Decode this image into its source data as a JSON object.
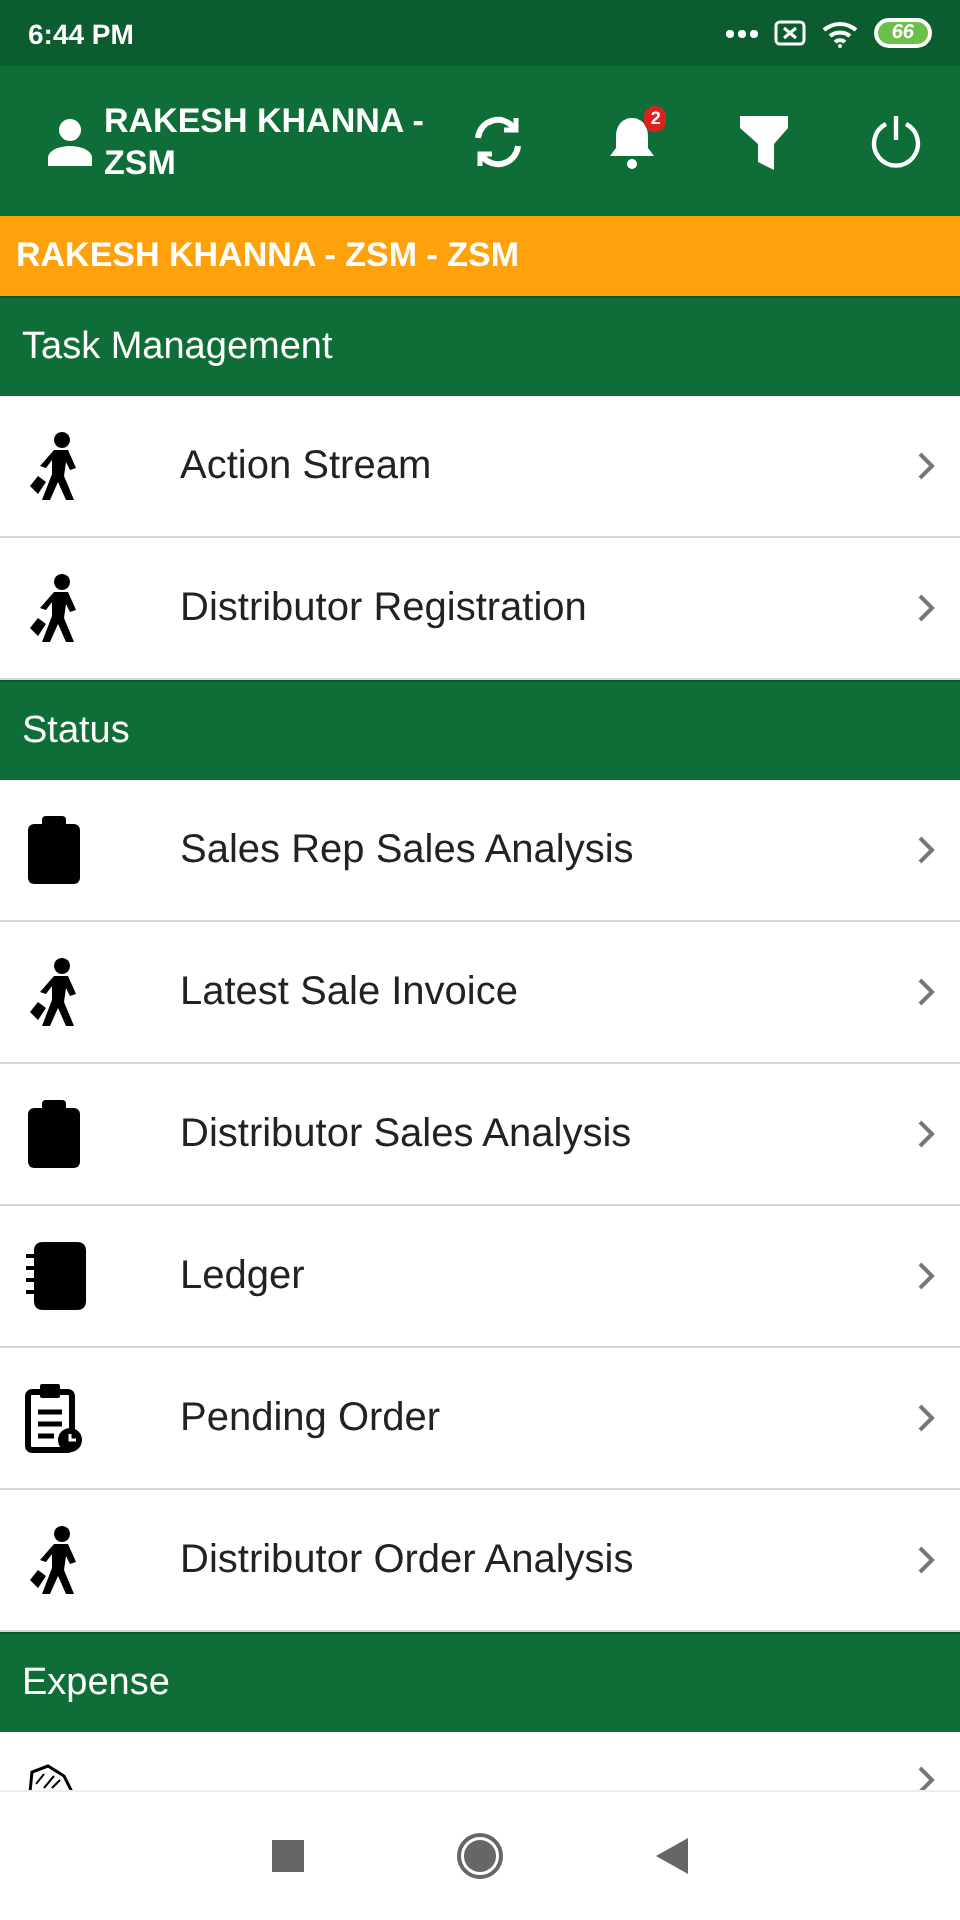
{
  "status_bar": {
    "time": "6:44 PM",
    "battery": "66"
  },
  "app_bar": {
    "user": "RAKESH KHANNA - ZSM",
    "notification_count": "2"
  },
  "banner": "RAKESH KHANNA - ZSM - ZSM",
  "sections": [
    {
      "title": "Task Management",
      "items": [
        {
          "label": "Action Stream",
          "kind": "traveler"
        },
        {
          "label": "Distributor Registration",
          "kind": "traveler"
        }
      ]
    },
    {
      "title": "Status",
      "items": [
        {
          "label": "Sales Rep Sales Analysis",
          "kind": "clipboard"
        },
        {
          "label": "Latest Sale Invoice",
          "kind": "traveler"
        },
        {
          "label": "Distributor Sales Analysis",
          "kind": "clipboard"
        },
        {
          "label": "Ledger",
          "kind": "notebook"
        },
        {
          "label": "Pending Order",
          "kind": "pending"
        },
        {
          "label": "Distributor Order Analysis",
          "kind": "traveler"
        }
      ]
    },
    {
      "title": "Expense",
      "items": [
        {
          "kind": "wallet"
        }
      ]
    }
  ]
}
